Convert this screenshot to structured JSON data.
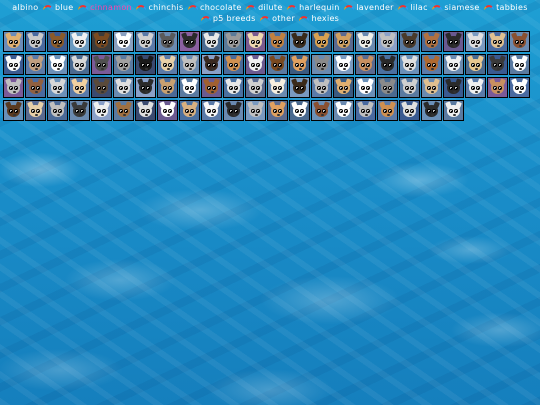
{
  "nav": {
    "items": [
      {
        "label": "albino",
        "color": "white"
      },
      {
        "label": "blue",
        "color": "white"
      },
      {
        "label": "cinnamon",
        "color": "pink"
      },
      {
        "label": "chinchis",
        "color": "white"
      },
      {
        "label": "chocolate",
        "color": "white"
      },
      {
        "label": "dilute",
        "color": "white"
      },
      {
        "label": "harlequin",
        "color": "white"
      },
      {
        "label": "lavender",
        "color": "white"
      },
      {
        "label": "lilac",
        "color": "white"
      },
      {
        "label": "siamese",
        "color": "white"
      },
      {
        "label": "tabbies",
        "color": "white"
      },
      {
        "label": "p5 breeds",
        "color": "white"
      },
      {
        "label": "other",
        "color": "white"
      },
      {
        "label": "hexies",
        "color": "white"
      }
    ]
  },
  "tiles": [
    {
      "bg": "#6b8bb8",
      "face": "#e0b070"
    },
    {
      "bg": "#4a6aa0",
      "face": "#c9c9c9"
    },
    {
      "bg": "#3a5a90",
      "face": "#8a5a2a"
    },
    {
      "bg": "#6a9ac0",
      "face": "#f0f0f0"
    },
    {
      "bg": "#3b3b3b",
      "face": "#7a4a20"
    },
    {
      "bg": "#8aa0c0",
      "face": "#ffffff"
    },
    {
      "bg": "#5a7aa8",
      "face": "#d0d0d0"
    },
    {
      "bg": "#6a8ab0",
      "face": "#5a5a5a"
    },
    {
      "bg": "#8a60a0",
      "face": "#2a2a2a"
    },
    {
      "bg": "#4a6a90",
      "face": "#e8e8e8"
    },
    {
      "bg": "#5a7a98",
      "face": "#9a9a9a"
    },
    {
      "bg": "#7a5a90",
      "face": "#f0d8b0"
    },
    {
      "bg": "#4a70a0",
      "face": "#c08040"
    },
    {
      "bg": "#6a90b8",
      "face": "#3a2a1a"
    },
    {
      "bg": "#3a5a80",
      "face": "#d8a050"
    },
    {
      "bg": "#5a6a90",
      "face": "#d0a060"
    },
    {
      "bg": "#6a8ab0",
      "face": "#f0f0e8"
    },
    {
      "bg": "#8aa0c8",
      "face": "#c0c0c0"
    },
    {
      "bg": "#5a7aa0",
      "face": "#4a3a2a"
    },
    {
      "bg": "#4a6a98",
      "face": "#b07040"
    },
    {
      "bg": "#6a5a90",
      "face": "#2a2a2a"
    },
    {
      "bg": "#7a9ac0",
      "face": "#e0e0e0"
    },
    {
      "bg": "#4a6aa0",
      "face": "#e0c090"
    },
    {
      "bg": "#6a8ab0",
      "face": "#8a5030"
    },
    {
      "bg": "#3a5a90",
      "face": "#f8f8f8"
    },
    {
      "bg": "#5a7aa8",
      "face": "#c0a080"
    },
    {
      "bg": "#6a90b8",
      "face": "#ffffff"
    },
    {
      "bg": "#4a6a90",
      "face": "#d8d8d8"
    },
    {
      "bg": "#7a5a98",
      "face": "#505050"
    },
    {
      "bg": "#5a7aa0",
      "face": "#a0a0a0"
    },
    {
      "bg": "#3a4a70",
      "face": "#1a1a1a"
    },
    {
      "bg": "#5a7aa8",
      "face": "#e8d0a8"
    },
    {
      "bg": "#6a8ab0",
      "face": "#c0c0c0"
    },
    {
      "bg": "#8aa0c8",
      "face": "#3a2a20"
    },
    {
      "bg": "#4a6a98",
      "face": "#d09050"
    },
    {
      "bg": "#6a5a90",
      "face": "#f0f0f0"
    },
    {
      "bg": "#5a7aa0",
      "face": "#7a4a20"
    },
    {
      "bg": "#3a5a80",
      "face": "#e0a060"
    },
    {
      "bg": "#6a8ab0",
      "face": "#8a8a8a"
    },
    {
      "bg": "#7a9ac0",
      "face": "#ffffff"
    },
    {
      "bg": "#5a6a90",
      "face": "#c89060"
    },
    {
      "bg": "#4a70a0",
      "face": "#2a2a2a"
    },
    {
      "bg": "#6a90b8",
      "face": "#e0e0e0"
    },
    {
      "bg": "#5a7aa8",
      "face": "#b06a30"
    },
    {
      "bg": "#6a8ab0",
      "face": "#f0f0f0"
    },
    {
      "bg": "#4a6a90",
      "face": "#e8c890"
    },
    {
      "bg": "#3a5a90",
      "face": "#3a3a3a"
    },
    {
      "bg": "#5a7aa0",
      "face": "#ffffff"
    },
    {
      "bg": "#7a5a98",
      "face": "#c0c0c0"
    },
    {
      "bg": "#4a6aa0",
      "face": "#906040"
    },
    {
      "bg": "#6a90b8",
      "face": "#d8d8d8"
    },
    {
      "bg": "#5a7aa8",
      "face": "#f0d0a0"
    },
    {
      "bg": "#3a4a70",
      "face": "#5a4a3a"
    },
    {
      "bg": "#6a8ab0",
      "face": "#e0e0e0"
    },
    {
      "bg": "#8aa0c8",
      "face": "#2a2a2a"
    },
    {
      "bg": "#4a6a98",
      "face": "#c8a070"
    },
    {
      "bg": "#5a7aa0",
      "face": "#ffffff"
    },
    {
      "bg": "#6a5a90",
      "face": "#a06030"
    },
    {
      "bg": "#4a70a0",
      "face": "#e8e8e8"
    },
    {
      "bg": "#5a6a90",
      "face": "#d0d0d0"
    },
    {
      "bg": "#6a8ab0",
      "face": "#f8f0e0"
    },
    {
      "bg": "#7a9ac0",
      "face": "#3a2a1a"
    },
    {
      "bg": "#5a7aa8",
      "face": "#c0c0c0"
    },
    {
      "bg": "#3a5a80",
      "face": "#e0b070"
    },
    {
      "bg": "#6a90b8",
      "face": "#ffffff"
    },
    {
      "bg": "#4a6a90",
      "face": "#8a8a8a"
    },
    {
      "bg": "#5a7aa0",
      "face": "#d0d0d0"
    },
    {
      "bg": "#6a8ab0",
      "face": "#e0c090"
    },
    {
      "bg": "#3a5a90",
      "face": "#2a2a2a"
    },
    {
      "bg": "#5a7aa8",
      "face": "#f0f0f0"
    },
    {
      "bg": "#7a5a98",
      "face": "#c89060"
    },
    {
      "bg": "#4a6aa0",
      "face": "#ffffff"
    },
    {
      "bg": "#6a90b8",
      "face": "#5a3a20"
    },
    {
      "bg": "#5a6a90",
      "face": "#e8d0a8"
    },
    {
      "bg": "#4a6a98",
      "face": "#c0c0c0"
    },
    {
      "bg": "#6a8ab0",
      "face": "#3a3a3a"
    },
    {
      "bg": "#8aa0c8",
      "face": "#f0f0f0"
    },
    {
      "bg": "#5a7aa0",
      "face": "#a07040"
    },
    {
      "bg": "#3a4a70",
      "face": "#e0e0e0"
    },
    {
      "bg": "#6a5a90",
      "face": "#ffffff"
    },
    {
      "bg": "#4a70a0",
      "face": "#d8b080"
    },
    {
      "bg": "#5a7aa8",
      "face": "#f8f8f8"
    },
    {
      "bg": "#6a8ab0",
      "face": "#2a2a2a"
    },
    {
      "bg": "#7a9ac0",
      "face": "#c0c0c0"
    },
    {
      "bg": "#5a6a90",
      "face": "#e0a060"
    },
    {
      "bg": "#4a6a90",
      "face": "#ffffff"
    },
    {
      "bg": "#6a90b8",
      "face": "#8a5030"
    },
    {
      "bg": "#6a8ab0",
      "face": "#ffffff"
    },
    {
      "bg": "#4a6aa0",
      "face": "#c0c0c0"
    },
    {
      "bg": "#5a7aa8",
      "face": "#d09050"
    },
    {
      "bg": "#3a5a90",
      "face": "#e0e0e0"
    },
    {
      "bg": "#6a90b8",
      "face": "#2a2a2a"
    },
    {
      "bg": "#5a7aa0",
      "face": "#f0f0f0"
    }
  ]
}
